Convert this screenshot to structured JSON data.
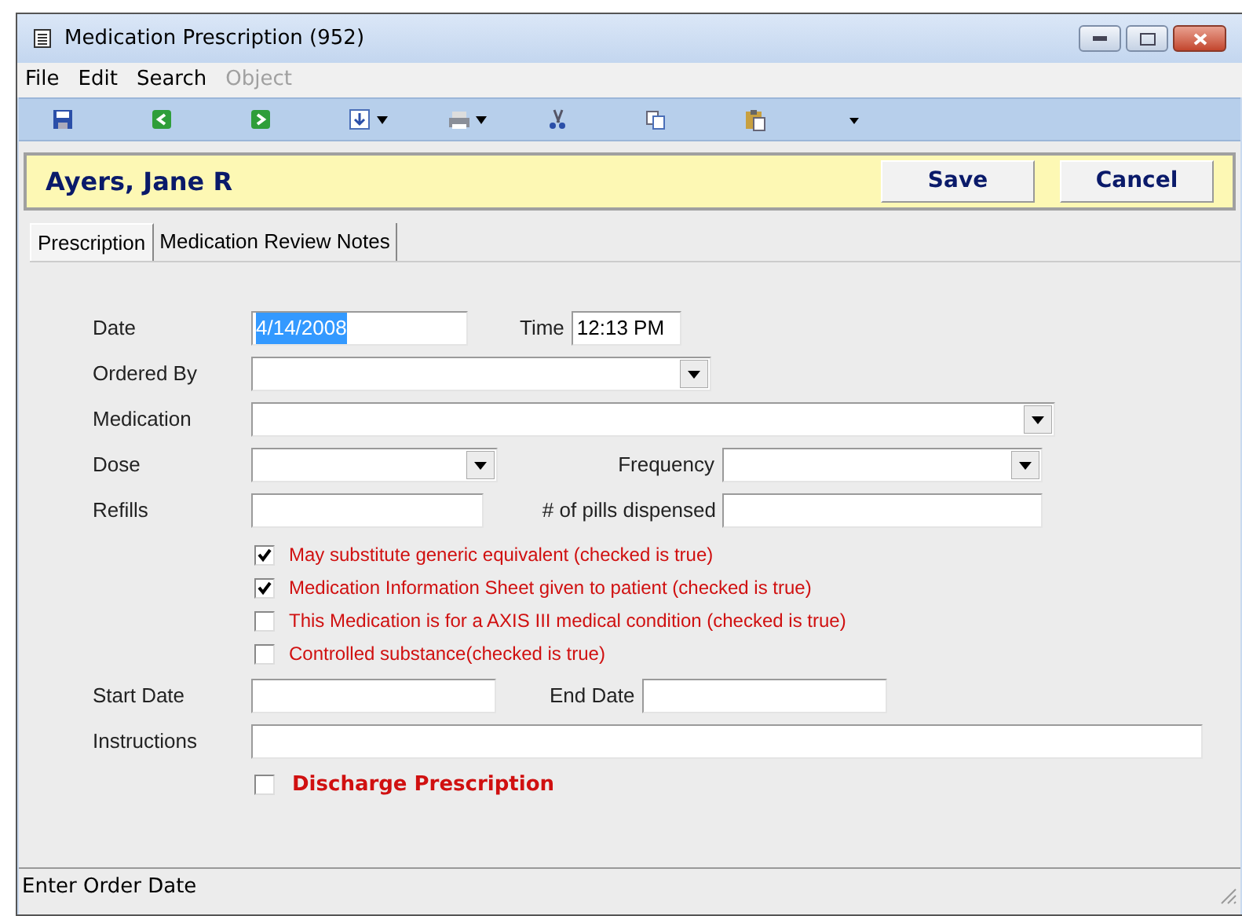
{
  "window": {
    "title": "Medication Prescription (952)"
  },
  "menu": [
    {
      "label": "File",
      "disabled": false
    },
    {
      "label": "Edit",
      "disabled": false
    },
    {
      "label": "Search",
      "disabled": false
    },
    {
      "label": "Object",
      "disabled": true
    }
  ],
  "toolbar": [
    {
      "kind": "save"
    },
    {
      "kind": "back"
    },
    {
      "kind": "forward"
    },
    {
      "kind": "import",
      "dropdown": true
    },
    {
      "kind": "print",
      "dropdown": true
    },
    {
      "kind": "cut"
    },
    {
      "kind": "copy"
    },
    {
      "kind": "paste"
    },
    {
      "kind": "more"
    }
  ],
  "header": {
    "patient": "Ayers, Jane R",
    "buttons": [
      "Save",
      "Cancel"
    ]
  },
  "tabs": [
    {
      "label": "Prescription",
      "selected": true
    },
    {
      "label": "Medication Review Notes",
      "selected": false
    }
  ],
  "form": {
    "date": {
      "label": "Date",
      "value": "4/14/2008",
      "selected_text": true
    },
    "time": {
      "label": "Time",
      "value": "12:13 PM"
    },
    "ordered_by": {
      "label": "Ordered By"
    },
    "medication": {
      "label": "Medication"
    },
    "dose": {
      "label": "Dose"
    },
    "frequency": {
      "label": "Frequency"
    },
    "refills": {
      "label": "Refills"
    },
    "pills": {
      "label": "# of pills dispensed"
    },
    "checks": [
      {
        "label": "May substitute generic equivalent (checked is true)",
        "checked": true
      },
      {
        "label": "Medication  Information Sheet given to patient (checked is true)",
        "checked": true
      },
      {
        "label": "This Medication is for a AXIS III medical condition (checked is true)",
        "checked": false
      },
      {
        "label": "Controlled substance(checked is true)",
        "checked": false
      }
    ],
    "start_date": {
      "label": "Start Date"
    },
    "end_date": {
      "label": "End Date"
    },
    "instructions": {
      "label": "Instructions"
    },
    "discharge": {
      "label": "Discharge Prescription",
      "checked": false
    }
  },
  "status_bar": "Enter Order Date"
}
